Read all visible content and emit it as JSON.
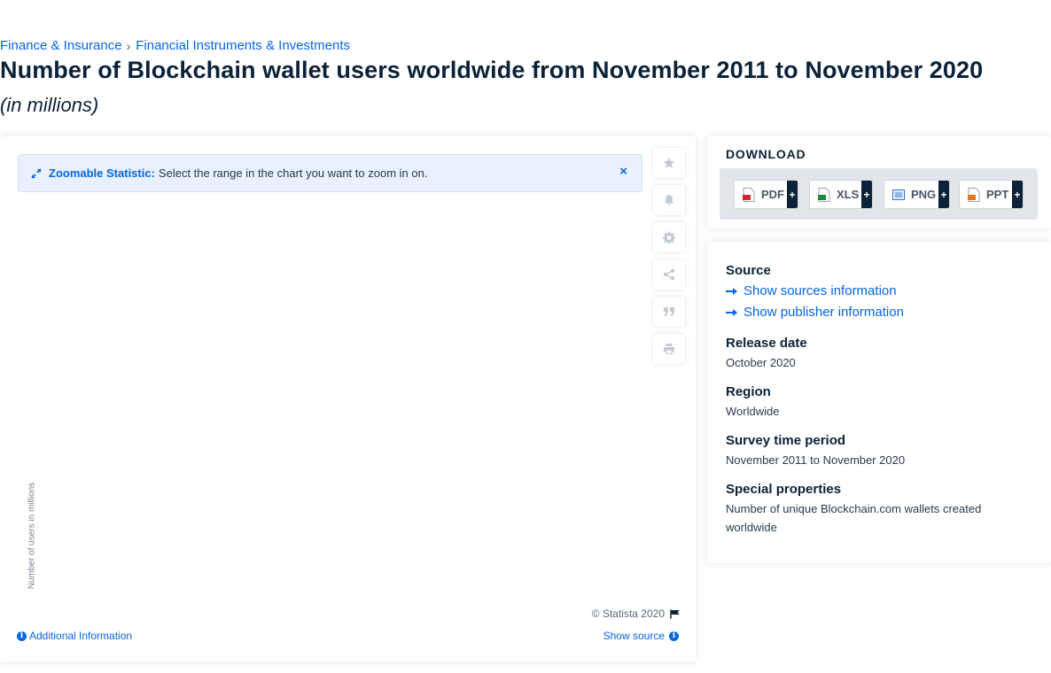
{
  "breadcrumb": {
    "items": [
      "Finance & Insurance",
      "Financial Instruments & Investments"
    ],
    "separator": "›"
  },
  "title": "Number of Blockchain wallet users worldwide from November 2011 to November 2020",
  "subtitle": "(in millions)",
  "chart": {
    "zoom_label": "Zoomable Statistic:",
    "zoom_text": "Select the range in the chart you want to zoom in on.",
    "close_symbol": "×",
    "y_axis_label": "Number of users in millions",
    "copyright": "© Statista 2020",
    "additional_info": "Additional Information",
    "show_source": "Show source",
    "toolbar": [
      "star-icon",
      "bell-icon",
      "gear-icon",
      "share-icon",
      "quote-icon",
      "print-icon"
    ]
  },
  "download": {
    "title": "DOWNLOAD",
    "formats": [
      {
        "label": "PDF",
        "icon": "pdf-file-icon",
        "color": "#d9242b"
      },
      {
        "label": "XLS",
        "icon": "xls-file-icon",
        "color": "#1f8a3c"
      },
      {
        "label": "PNG",
        "icon": "png-file-icon",
        "color": "#2a6fd6"
      },
      {
        "label": "PPT",
        "icon": "ppt-file-icon",
        "color": "#e8771e"
      }
    ],
    "plus_symbol": "+"
  },
  "info": {
    "source_heading": "Source",
    "show_sources": "Show sources information",
    "show_publisher": "Show publisher information",
    "release_date_heading": "Release date",
    "release_date": "October 2020",
    "region_heading": "Region",
    "region": "Worldwide",
    "survey_period_heading": "Survey time period",
    "survey_period": "November 2011 to November 2020",
    "special_properties_heading": "Special properties",
    "special_properties": "Number of unique Blockchain.com wallets created worldwide"
  },
  "colors": {
    "accent": "#0666e5",
    "dark": "#0b2238",
    "notice_bg": "#e8f1fd",
    "download_bar": "#e2e6eb"
  }
}
